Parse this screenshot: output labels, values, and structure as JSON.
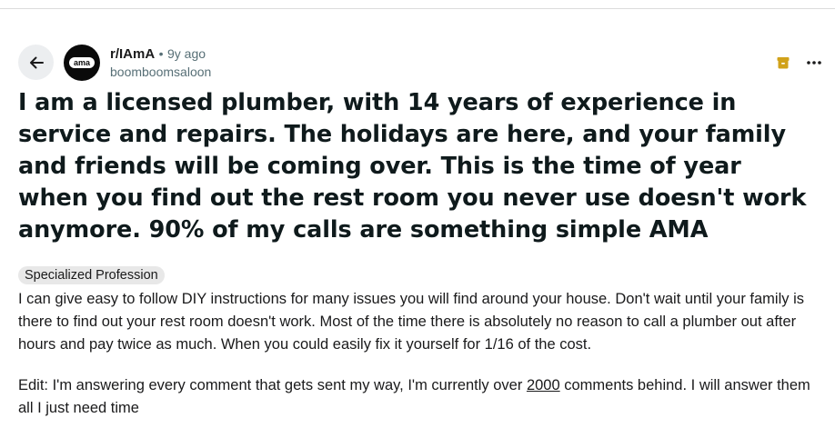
{
  "post": {
    "subreddit": "r/IAmA",
    "separator": "•",
    "age": "9y ago",
    "author": "boomboomsaloon",
    "avatar_text": "ama",
    "title": "I am a licensed plumber, with 14 years of experience in service and repairs. The holidays are here, and your family and friends will be coming over. This is the time of year when you find out the rest room you never use doesn't work anymore. 90% of my calls are something simple AMA",
    "flair": "Specialized Profession",
    "body_paragraph_1": "I can give easy to follow DIY instructions for many issues you will find around your house. Don't wait until your family is there to find out your rest room doesn't work. Most of the time there is absolutely no reason to call a plumber out after hours and pay twice as much. When you could easily fix it yourself for 1/16 of the cost.",
    "body_paragraph_2_before": "Edit: I'm answering every comment that gets sent my way, I'm currently over ",
    "body_paragraph_2_link": "2000",
    "body_paragraph_2_after": " comments behind. I will answer them all I just need time"
  },
  "icons": {
    "back": "arrow-left-icon",
    "archive": "archive-icon",
    "more": "more-horizontal-icon"
  },
  "colors": {
    "archive_icon": "#d1a21a",
    "meta_gray": "#576f76",
    "flair_bg": "#e8e8e8"
  }
}
